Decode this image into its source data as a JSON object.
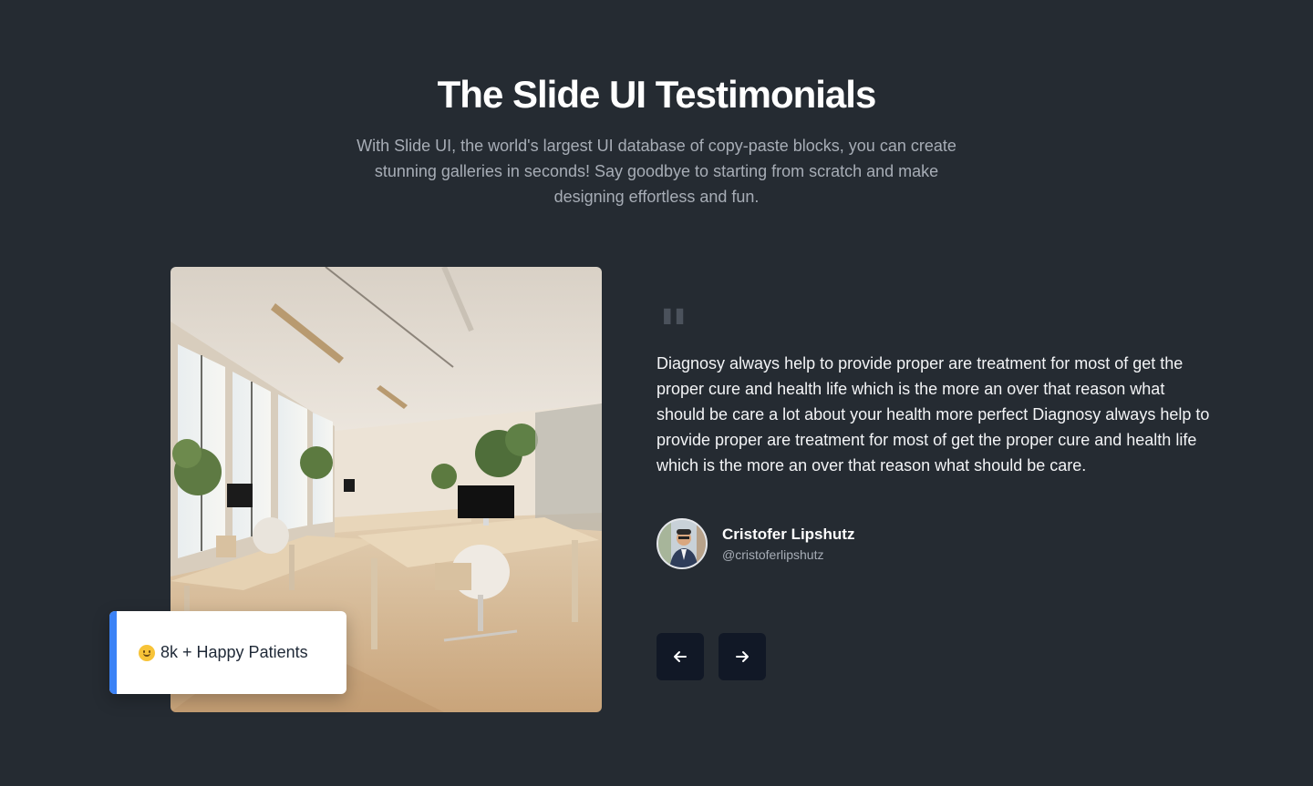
{
  "header": {
    "title": "The Slide UI Testimonials",
    "subtitle": "With Slide UI, the world's largest UI database of copy-paste blocks, you can create stunning galleries in seconds! Say goodbye to starting from scratch and make designing effortless and fun."
  },
  "image": {
    "icon": "office-interior-photo"
  },
  "badge": {
    "icon": "smiling-face-emoji",
    "text": "8k + Happy Patients",
    "accent_color": "#3b82f6"
  },
  "testimonial": {
    "quote_icon": "quote-icon",
    "text": "Diagnosy always help to provide proper are treatment for most of get the proper cure and health life which is the more an over that reason what should be care a lot about your health more perfect Diagnosy always help to provide proper are treatment for most of get the proper cure and health life which is the more an over that reason what should be care.",
    "author": {
      "name": "Cristofer Lipshutz",
      "handle": "@cristoferlipshutz"
    }
  },
  "navigation": {
    "prev_icon": "arrow-left-icon",
    "next_icon": "arrow-right-icon"
  },
  "colors": {
    "background": "#252b32",
    "button": "#111826"
  }
}
